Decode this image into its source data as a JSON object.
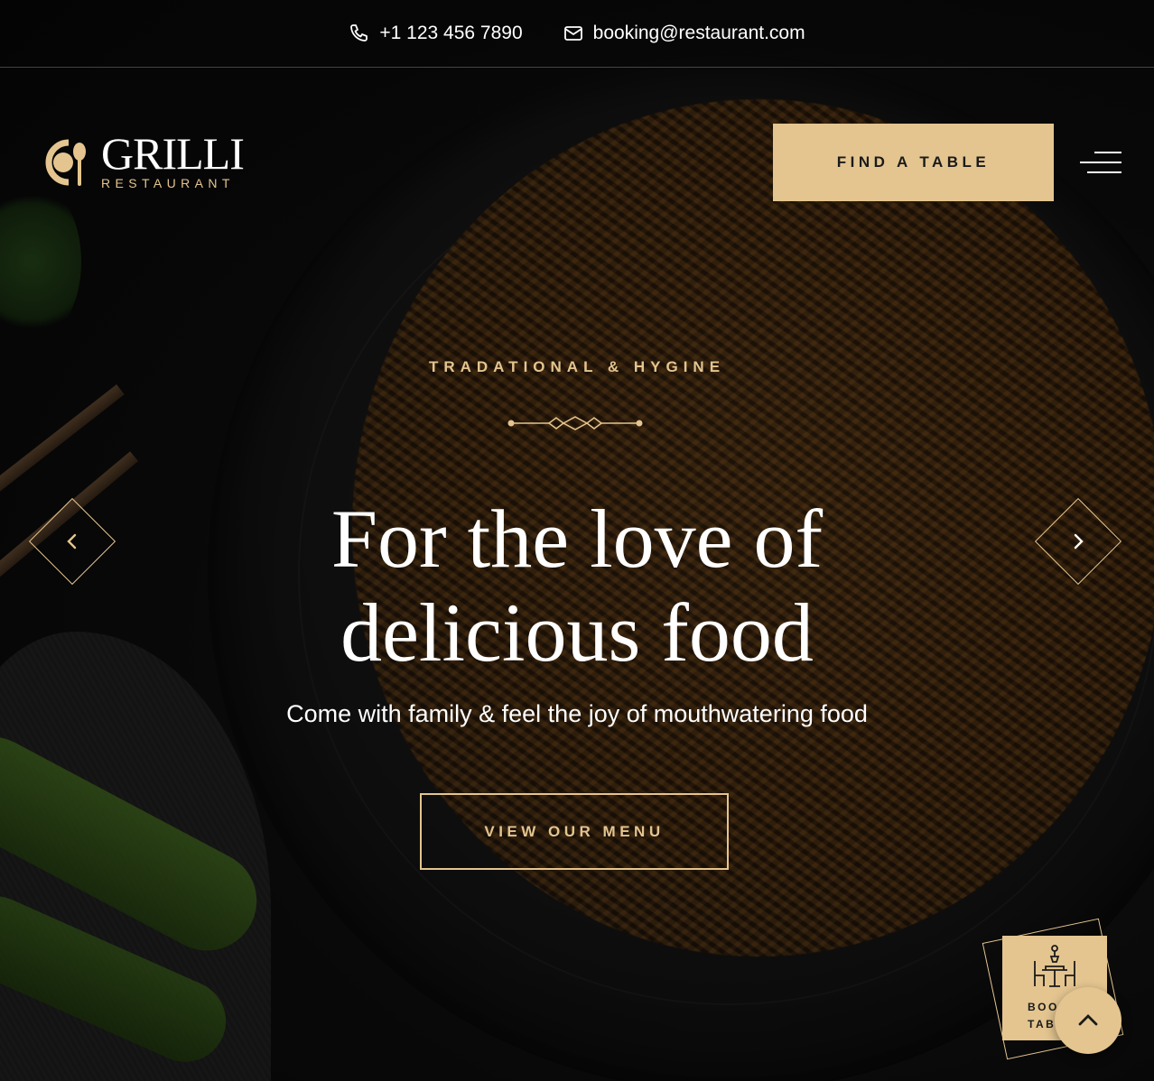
{
  "topbar": {
    "phone": "+1 123 456 7890",
    "email": "booking@restaurant.com"
  },
  "brand": {
    "name": "GRILLI",
    "sub": "RESTAURANT"
  },
  "header": {
    "cta": "FIND A TABLE"
  },
  "hero": {
    "subtitle": "TRADATIONAL & HYGINE",
    "title_line1": "For the love of",
    "title_line2": "delicious food",
    "tagline": "Come with family & feel the joy of mouthwatering food",
    "button": "VIEW OUR MENU"
  },
  "book_table": {
    "line1": "BOOK",
    "line2": "TABLE"
  },
  "colors": {
    "accent": "#e4c590",
    "background": "#0f0f0f",
    "text": "#ffffff"
  },
  "icons": [
    "phone-icon",
    "mail-icon",
    "hamburger-icon",
    "chevron-left-icon",
    "chevron-right-icon",
    "dining-table-icon",
    "chevron-up-icon"
  ]
}
